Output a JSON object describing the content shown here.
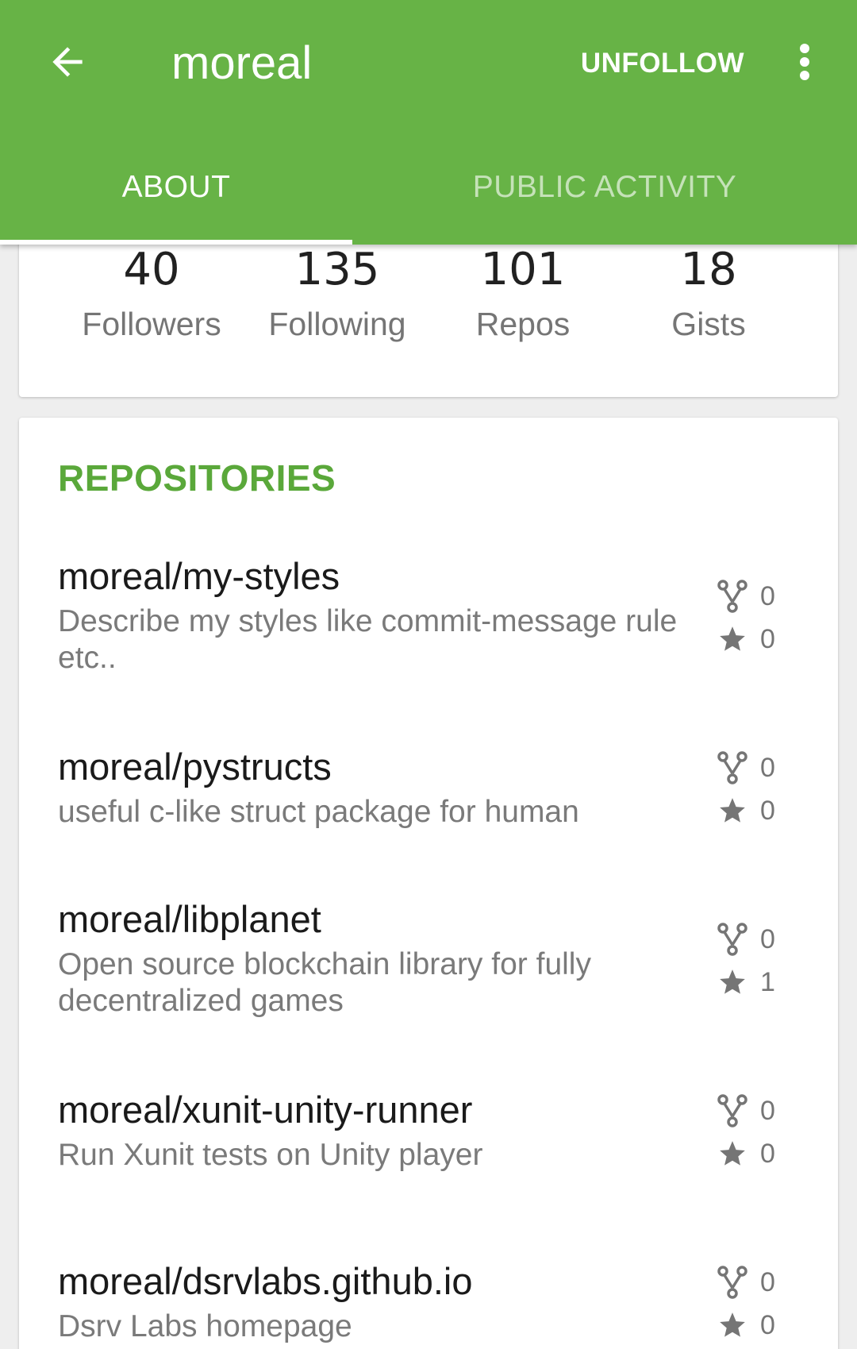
{
  "appbar": {
    "title": "moreal",
    "unfollow_label": "UNFOLLOW"
  },
  "tabs": [
    {
      "label": "ABOUT",
      "active": true
    },
    {
      "label": "PUBLIC ACTIVITY",
      "active": false
    }
  ],
  "stats": [
    {
      "value": "40",
      "label": "Followers"
    },
    {
      "value": "135",
      "label": "Following"
    },
    {
      "value": "101",
      "label": "Repos"
    },
    {
      "value": "18",
      "label": "Gists"
    }
  ],
  "repositories": {
    "title": "REPOSITORIES",
    "items": [
      {
        "name": "moreal/my-styles",
        "description": "Describe my styles like commit-message rule etc..",
        "forks": "0",
        "stars": "0"
      },
      {
        "name": "moreal/pystructs",
        "description": "useful c-like struct package for human",
        "forks": "0",
        "stars": "0"
      },
      {
        "name": "moreal/libplanet",
        "description": "Open source blockchain library for fully decentralized games",
        "forks": "0",
        "stars": "1"
      },
      {
        "name": "moreal/xunit-unity-runner",
        "description": "Run Xunit tests on Unity player",
        "forks": "0",
        "stars": "0"
      },
      {
        "name": "moreal/dsrvlabs.github.io",
        "description": "Dsrv Labs homepage",
        "forks": "0",
        "stars": "0"
      }
    ]
  },
  "colors": {
    "primary": "#67b346",
    "accent_text": "#5aa83a",
    "background": "#eeeeee"
  },
  "icons": {
    "back": "arrow-left-icon",
    "overflow": "more-vert-icon",
    "fork": "fork-icon",
    "star": "star-icon"
  }
}
